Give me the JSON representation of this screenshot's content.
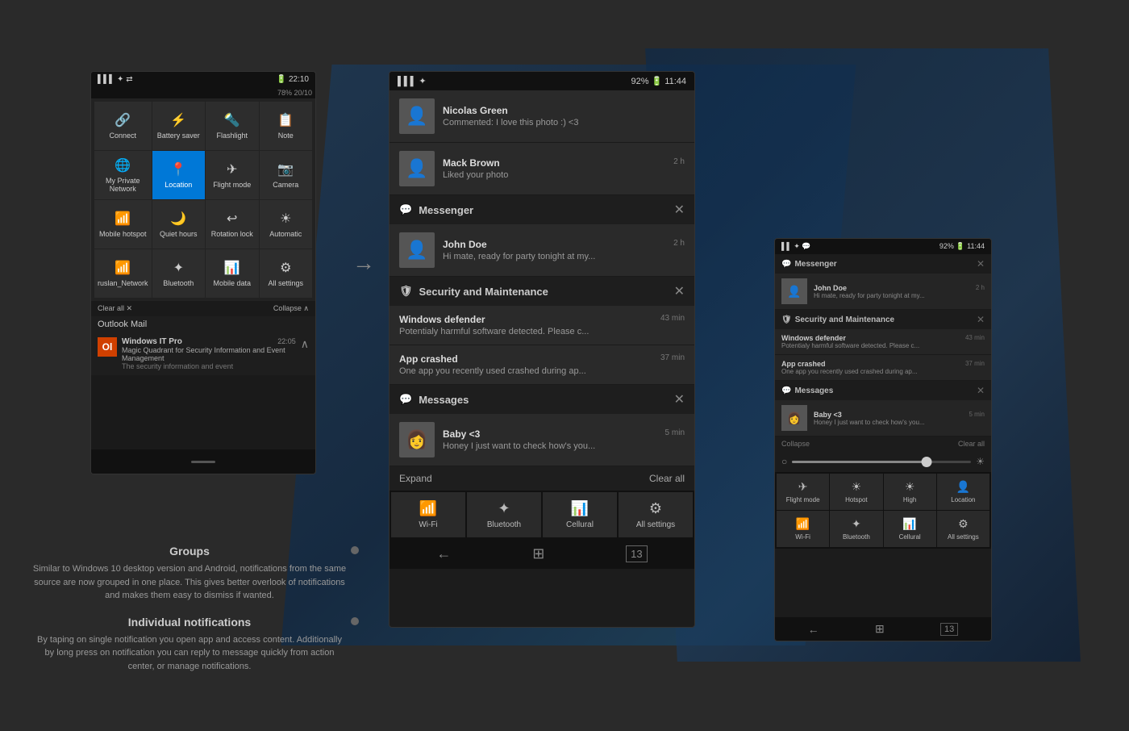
{
  "background": "#2a2a2a",
  "phoneLeft": {
    "statusBar": {
      "signalIcons": "▌▌▌ ✦ ⇄",
      "battery": "78%  20/10",
      "time": "22:10"
    },
    "quickSettings": [
      {
        "icon": "🔗",
        "label": "Connect",
        "active": false
      },
      {
        "icon": "⚡",
        "label": "Battery saver",
        "active": false
      },
      {
        "icon": "🔦",
        "label": "Flashlight",
        "active": false
      },
      {
        "icon": "📋",
        "label": "Note",
        "active": false
      },
      {
        "icon": "🌐",
        "label": "My Private Network",
        "active": false
      },
      {
        "icon": "📍",
        "label": "Location",
        "active": true
      },
      {
        "icon": "✈",
        "label": "Flight mode",
        "active": false
      },
      {
        "icon": "📷",
        "label": "Camera",
        "active": false
      },
      {
        "icon": "📶",
        "label": "Mobile hotspot",
        "active": false
      },
      {
        "icon": "🌙",
        "label": "Quiet hours",
        "active": false
      },
      {
        "icon": "↩",
        "label": "Rotation lock",
        "active": false
      },
      {
        "icon": "☀",
        "label": "Automatic",
        "active": false
      },
      {
        "icon": "📶",
        "label": "ruslan_Network",
        "active": false
      },
      {
        "icon": "✦",
        "label": "Bluetooth",
        "active": false
      },
      {
        "icon": "📊",
        "label": "Mobile data",
        "active": false
      },
      {
        "icon": "⚙",
        "label": "All settings",
        "active": false
      }
    ],
    "actionBar": {
      "clearAll": "Clear all ✕",
      "collapse": "Collapse ∧"
    },
    "outlookSection": "Outlook Mail",
    "emailItem": {
      "sender": "Windows IT Pro",
      "time": "22:05",
      "subject": "Magic Quadrant for Security Information and Event Management",
      "preview": "The security information and event"
    }
  },
  "arrowLabel": "→",
  "phoneCenter": {
    "statusBar": {
      "signalIcons": "▌▌▌ ✦",
      "battery": "92% 🔋",
      "time": "11:44"
    },
    "notifications": [
      {
        "sender": "Nicolas Green",
        "message": "Commented: I love this photo :) <3",
        "time": "",
        "avatar": "👤"
      },
      {
        "sender": "Mack Brown",
        "message": "Liked your photo",
        "time": "2 h",
        "avatar": "👤"
      }
    ],
    "groups": [
      {
        "app": "Messenger",
        "icon": "💬",
        "items": [
          {
            "sender": "John Doe",
            "message": "Hi mate, ready for party tonight at my...",
            "time": "2 h",
            "avatar": "👤"
          }
        ]
      },
      {
        "app": "Security and Maintenance",
        "icon": "🛡",
        "items": [
          {
            "sender": "Windows defender",
            "message": "Potentialy harmful software detected. Please  c...",
            "time": "43 min",
            "avatar": ""
          },
          {
            "sender": "App crashed",
            "message": "One app you recently used crashed during  ap...",
            "time": "37 min",
            "avatar": ""
          }
        ]
      },
      {
        "app": "Messages",
        "icon": "💬",
        "items": [
          {
            "sender": "Baby <3",
            "message": "Honey I just want to check how's you...",
            "time": "5 min",
            "avatar": "👩"
          }
        ]
      }
    ],
    "bottomBar": {
      "expand": "Expand",
      "clearAll": "Clear all"
    },
    "quickSettings": [
      {
        "icon": "📶",
        "label": "Wi-Fi"
      },
      {
        "icon": "✦",
        "label": "Bluetooth"
      },
      {
        "icon": "📊",
        "label": "Cellural"
      },
      {
        "icon": "⚙",
        "label": "All settings"
      }
    ],
    "nav": {
      "back": "←",
      "home": "⊞",
      "apps": "13"
    }
  },
  "phoneRight": {
    "statusBar": {
      "signalIcons": "▌▌ ✦",
      "battery": "92% 🔋",
      "time": "11:44"
    },
    "messengerSection": {
      "app": "Messenger",
      "icon": "💬",
      "closeIcon": "✕",
      "items": [
        {
          "sender": "John Doe",
          "message": "Hi mate, ready for party tonight at my...",
          "time": "2 h",
          "avatar": "👤"
        }
      ]
    },
    "securitySection": {
      "app": "Security and Maintenance",
      "icon": "🛡",
      "closeIcon": "✕",
      "items": [
        {
          "sender": "Windows defender",
          "message": "Potentialy harmful software detected. Please  c...",
          "time": "43 min"
        },
        {
          "sender": "App crashed",
          "message": "One app you recently used crashed during  ap...",
          "time": "37 min"
        }
      ]
    },
    "messagesSection": {
      "app": "Messages",
      "icon": "💬",
      "closeIcon": "✕",
      "items": [
        {
          "sender": "Baby <3",
          "message": "Honey I just want to check how's you...",
          "time": "5 min",
          "avatar": "👩"
        }
      ]
    },
    "actionBar": {
      "collapse": "Collapse",
      "clearAll": "Clear all"
    },
    "slider": {
      "leftIcon": "○",
      "rightIcon": "☀",
      "value": 75
    },
    "quickSettings": [
      {
        "icon": "✈",
        "label": "Flight mode"
      },
      {
        "icon": "☀",
        "label": "Hotspot"
      },
      {
        "icon": "☀",
        "label": "High"
      },
      {
        "icon": "👤",
        "label": "Location"
      },
      {
        "icon": "📶",
        "label": "Wi-Fi"
      },
      {
        "icon": "✦",
        "label": "Bluetooth"
      },
      {
        "icon": "📊",
        "label": "Cellural"
      },
      {
        "icon": "⚙",
        "label": "All settings"
      }
    ],
    "nav": {
      "back": "←",
      "home": "⊞",
      "apps": "13"
    }
  },
  "textSection": {
    "groups": {
      "heading": "Groups",
      "body": "Similar to Windows 10 desktop version and Android, notifications from the same source are now grouped in one place. This gives better overlook of notifications and makes them easy to dismiss if wanted."
    },
    "individualNotifications": {
      "heading": "Individual notifications",
      "body": "By taping on single notification you open app and access content. Additionally by long press on notification you can reply to message quickly from action center, or manage notifications."
    }
  }
}
